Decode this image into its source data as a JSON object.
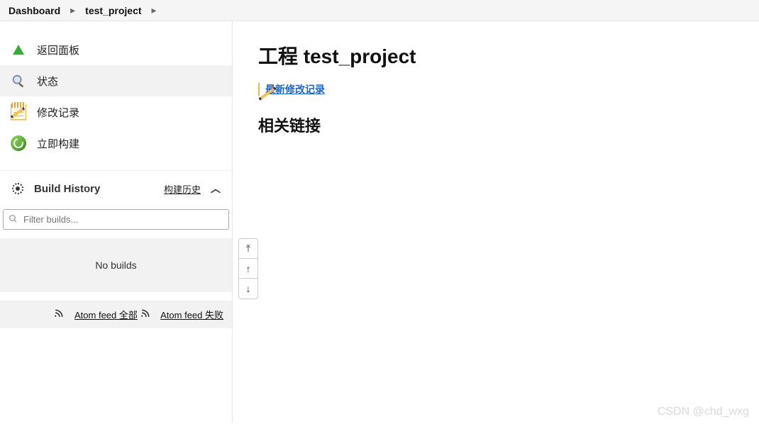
{
  "breadcrumb": {
    "dashboard": "Dashboard",
    "project": "test_project"
  },
  "sidebar": {
    "items": [
      {
        "label": "返回面板"
      },
      {
        "label": "状态"
      },
      {
        "label": "修改记录"
      },
      {
        "label": "立即构建"
      }
    ],
    "build_history": {
      "title": "Build History",
      "link_label": "构建历史",
      "filter_placeholder": "Filter builds...",
      "no_builds": "No builds",
      "feed_all": "Atom feed 全部",
      "feed_failed": "Atom feed 失败"
    }
  },
  "main": {
    "title": "工程 test_project",
    "changes_link": "最新修改记录",
    "related_heading": "相关链接"
  },
  "watermark": "CSDN @chd_wxg"
}
